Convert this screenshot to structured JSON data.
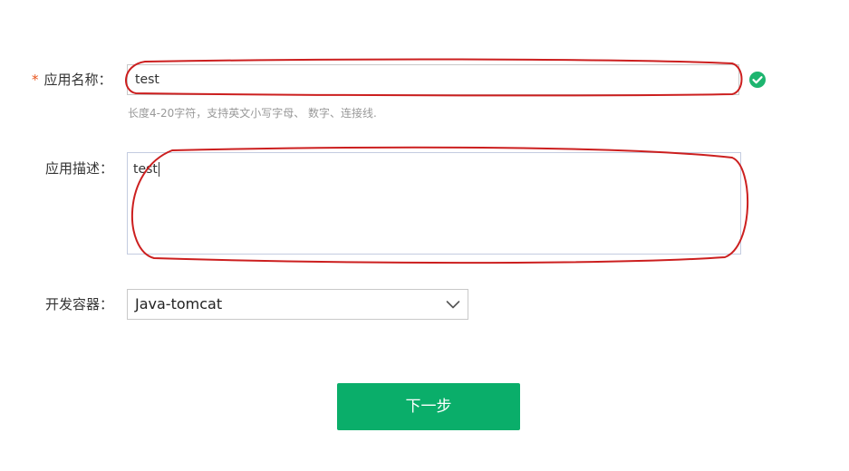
{
  "form": {
    "app_name": {
      "required_mark": "*",
      "label": "应用名称：",
      "value": "test",
      "hint": "长度4-20字符，支持英文小写字母、 数字、连接线.",
      "valid_icon": "check-circle-icon",
      "valid_color": "#1db56f"
    },
    "app_description": {
      "label": "应用描述：",
      "value": "test"
    },
    "container": {
      "label": "开发容器：",
      "selected": "Java-tomcat",
      "dropdown_icon": "chevron-down-icon"
    },
    "next_button": {
      "label": "下一步",
      "color": "#0aae6a"
    }
  },
  "annotations": {
    "highlight_color": "#cc1f1f"
  }
}
